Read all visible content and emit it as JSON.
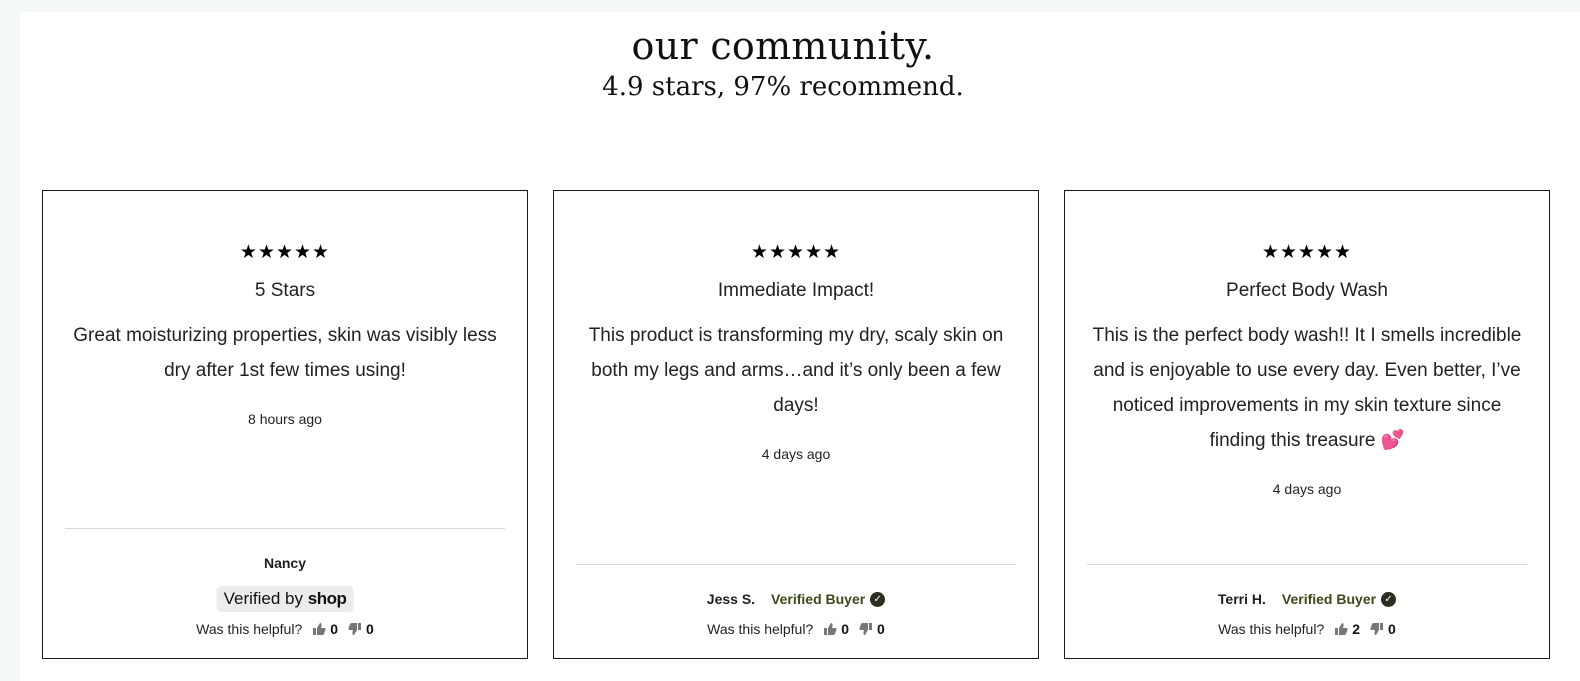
{
  "header": {
    "title": "our community.",
    "subtitle": "4.9 stars, 97% recommend."
  },
  "colors": {
    "card_border": "#1a1a1a",
    "verified_text": "#3a4a1a",
    "badge_bg": "#ececec",
    "heart": "#e8355f"
  },
  "reviews": [
    {
      "stars": "★★★★★",
      "rating": 5,
      "title": "5 Stars",
      "body": "Great moisturizing properties, skin was visibly less dry after 1st few times using!",
      "time": "8 hours ago",
      "author": "Nancy",
      "badge_prefix": "Verified by",
      "badge_brand": "shop",
      "helpful_label": "Was this helpful?",
      "up": "0",
      "down": "0"
    },
    {
      "stars": "★★★★★",
      "rating": 5,
      "title": "Immediate Impact!",
      "body": "This product is transforming my dry, scaly skin on both my legs and arms…and it’s only been a few days!",
      "time": "4 days ago",
      "author": "Jess S.",
      "verified": "Verified Buyer",
      "helpful_label": "Was this helpful?",
      "up": "0",
      "down": "0"
    },
    {
      "stars": "★★★★★",
      "rating": 5,
      "title": "Perfect Body Wash",
      "body": "This is the perfect body wash!! It I smells incredible and is enjoyable to use every day. Even better, I’ve noticed improvements in my skin texture since finding this treasure",
      "emoji": "💕",
      "time": "4 days ago",
      "author": "Terri H.",
      "verified": "Verified Buyer",
      "helpful_label": "Was this helpful?",
      "up": "2",
      "down": "0"
    }
  ],
  "icons": {
    "thumbs_up": "thumbs-up-icon",
    "thumbs_down": "thumbs-down-icon",
    "verified_check": "check-circle-icon",
    "star": "star-icon"
  }
}
